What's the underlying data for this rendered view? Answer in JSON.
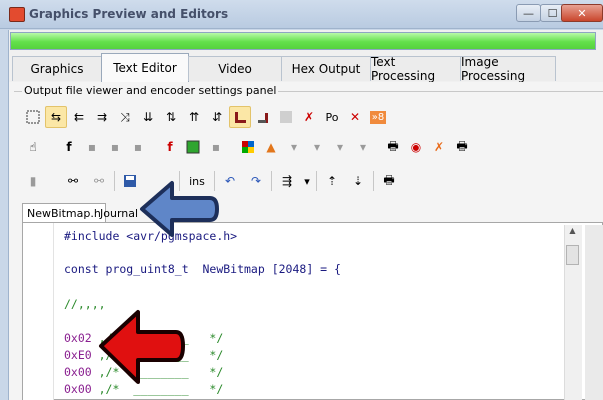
{
  "window": {
    "title": "Graphics Preview and Editors",
    "minimize": "—",
    "maximize": "☐",
    "close": "✕"
  },
  "main_tabs": {
    "graphics": "Graphics",
    "text_editor": "Text Editor",
    "video": "Video",
    "hex_output": "Hex Output",
    "text_processing": "Text Processing",
    "image_processing": "Image Processing"
  },
  "panel": {
    "group_label": "Output file viewer and encoder settings panel"
  },
  "toolbar": {
    "po_label": "Po",
    "r8_label": "»8",
    "ins_label": "ins",
    "f_label": "f"
  },
  "editor_tabs": {
    "newbitmap": "NewBitmap.h",
    "journal": "Journal"
  },
  "code": {
    "line1": "#include <avr/pgmspace.h>",
    "line2_kw": "const prog_uint8_t  NewBitmap [2048] = {",
    "line3": "//,,,,",
    "rows": [
      {
        "hex": "0x02",
        "comment": " ,/*  ________   */"
      },
      {
        "hex": "0xE0",
        "comment": " ,/*  ________   */"
      },
      {
        "hex": "0x00",
        "comment": " ,/*  ________   */"
      },
      {
        "hex": "0x00",
        "comment": " ,/*  ________   */"
      }
    ]
  },
  "colors": {
    "progress": "#55d23e",
    "arrow_blue": "#5f86c8",
    "arrow_red": "#e01010"
  }
}
